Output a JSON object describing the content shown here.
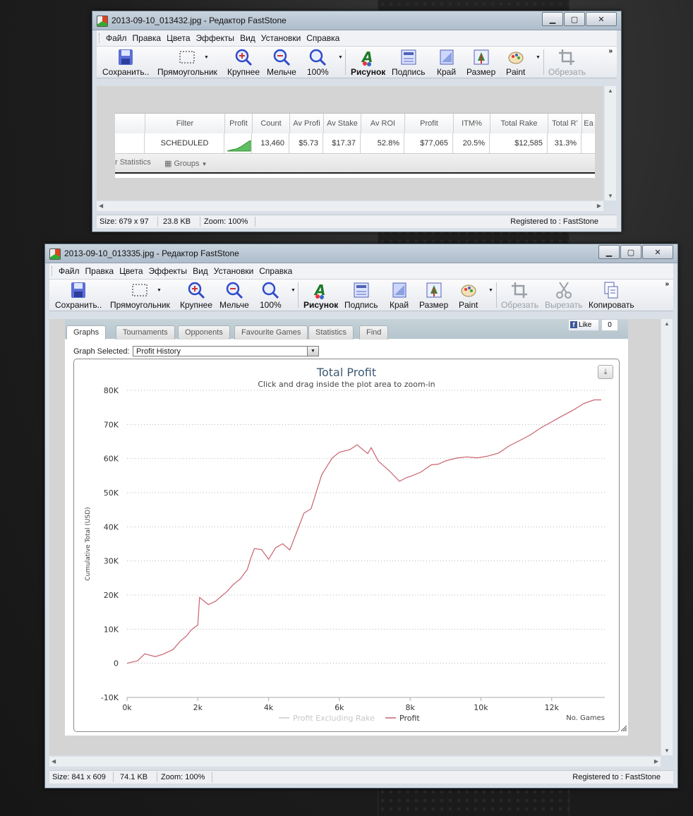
{
  "menu": [
    "Файл",
    "Правка",
    "Цвета",
    "Эффекты",
    "Вид",
    "Установки",
    "Справка"
  ],
  "window_buttons": {
    "min": "▁",
    "max": "▢",
    "close": "✕"
  },
  "toolbar_more": "»",
  "window1": {
    "title": "2013-09-10_013432.jpg - Редактор FastStone",
    "toolbar": [
      "Сохранить..",
      "Прямоугольник",
      "Крупнее",
      "Мельче",
      "100%",
      "Рисунок",
      "Подпись",
      "Край",
      "Размер",
      "Paint",
      "Обрезать"
    ],
    "status": {
      "size": "Size: 679 x 97",
      "filesize": "23.8 KB",
      "zoom": "Zoom: 100%",
      "registered": "Registered to : FastStone"
    },
    "table": {
      "headers": [
        "Filter",
        "Profit",
        "Count",
        "Av Profi",
        "Av Stake",
        "Av ROI",
        "Profit",
        "ITM%",
        "Total Rake",
        "Total R’",
        "Ea"
      ],
      "row": [
        "SCHEDULED",
        "",
        "13,460",
        "$5.73",
        "$17.37",
        "52.8%",
        "$77,065",
        "20.5%",
        "$12,585",
        "31.3%",
        ""
      ],
      "footer_left": "r Statistics",
      "footer_groups": "Groups"
    }
  },
  "window2": {
    "title": "2013-09-10_013335.jpg - Редактор FastStone",
    "toolbar": [
      "Сохранить..",
      "Прямоугольник",
      "Крупнее",
      "Мельче",
      "100%",
      "Рисунок",
      "Подпись",
      "Край",
      "Размер",
      "Paint",
      "Обрезать",
      "Вырезать",
      "Копировать"
    ],
    "status": {
      "size": "Size: 841 x 609",
      "filesize": "74.1 KB",
      "zoom": "Zoom: 100%",
      "registered": "Registered to : FastStone"
    },
    "tabs": [
      "Graphs",
      "Tournaments",
      "Opponents",
      "Favourite Games",
      "Statistics",
      "Find"
    ],
    "facebook": {
      "like": "Like",
      "count": "0"
    },
    "graph_selected_label": "Graph Selected:",
    "graph_selected_value": "Profit History"
  },
  "chart_data": {
    "type": "line",
    "title": "Total Profit",
    "subtitle": "Click and drag inside the plot area to zoom-in",
    "ylabel": "Cumulative Total (USD)",
    "xlabel": "No. Games",
    "ylim": [
      -10000,
      80000
    ],
    "xlim": [
      0,
      13500
    ],
    "yticks": [
      "-10K",
      "0",
      "10K",
      "20K",
      "30K",
      "40K",
      "50K",
      "60K",
      "70K",
      "80K"
    ],
    "xticks": [
      "0k",
      "2k",
      "4k",
      "6k",
      "8k",
      "10k",
      "12k"
    ],
    "grid": "horizontal dotted",
    "legend_position": "bottom-center",
    "colors": {
      "profit": "#c9636e",
      "excluding_rake": "#cccccc"
    },
    "series": [
      {
        "name": "Profit Excluding Rake",
        "x": [],
        "y": []
      },
      {
        "name": "Profit",
        "x": [
          0,
          300,
          500,
          800,
          1000,
          1300,
          1500,
          1700,
          1800,
          1900,
          2000,
          2050,
          2300,
          2500,
          2800,
          3000,
          3200,
          3400,
          3500,
          3600,
          3800,
          4000,
          4200,
          4400,
          4600,
          4800,
          5000,
          5200,
          5500,
          5700,
          5800,
          6000,
          6300,
          6500,
          6600,
          6800,
          6900,
          7100,
          7400,
          7700,
          7900,
          8000,
          8300,
          8600,
          8800,
          9000,
          9300,
          9600,
          9900,
          10200,
          10500,
          10800,
          11100,
          11400,
          11700,
          12000,
          12300,
          12600,
          12900,
          13200,
          13400
        ],
        "y": [
          0,
          1000,
          2500,
          2000,
          2500,
          4000,
          6500,
          8000,
          9500,
          10500,
          11500,
          19500,
          17000,
          18500,
          21000,
          23000,
          25000,
          27500,
          31000,
          33500,
          33500,
          30500,
          34000,
          35000,
          33000,
          38500,
          44000,
          45000,
          55000,
          58500,
          60500,
          62000,
          62500,
          64000,
          63000,
          61500,
          63500,
          59500,
          56500,
          53500,
          54500,
          55000,
          56000,
          58000,
          58500,
          59500,
          60000,
          60500,
          60000,
          60500,
          61500,
          63500,
          65500,
          67000,
          69000,
          71000,
          72500,
          74000,
          76000,
          77000,
          77000
        ]
      }
    ]
  }
}
